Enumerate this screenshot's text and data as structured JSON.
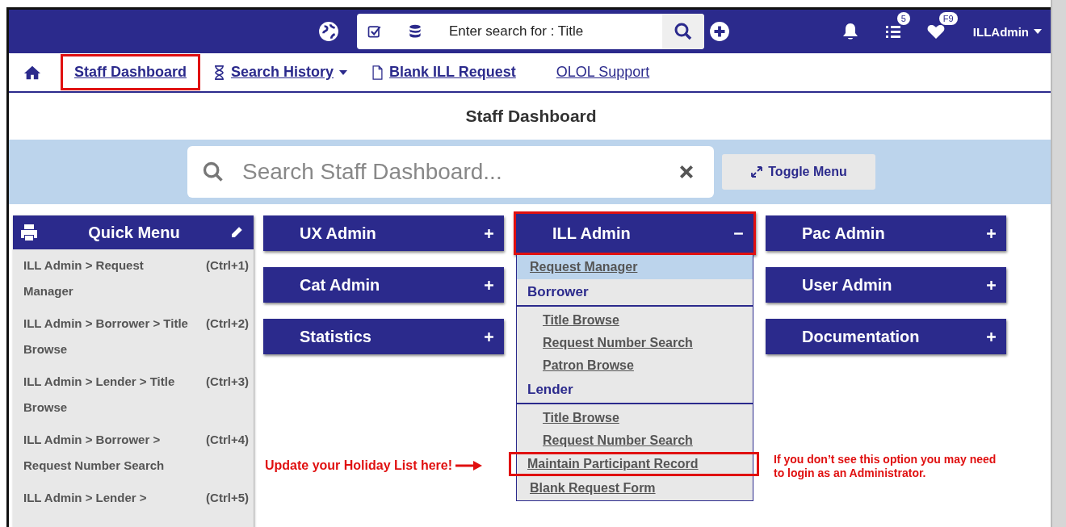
{
  "top_bar": {
    "search_placeholder": "Enter search for : Title",
    "list_badge": "5",
    "heart_badge": "F9",
    "user": "ILLAdmin"
  },
  "nav": [
    {
      "label": "Staff Dashboard",
      "kind": "page",
      "highlighted": true
    },
    {
      "label": "Search History",
      "kind": "history",
      "highlighted": false
    },
    {
      "label": "Blank ILL Request",
      "kind": "document",
      "highlighted": false
    },
    {
      "label": "OLOL Support",
      "kind": "external",
      "highlighted": false
    }
  ],
  "page_title": "Staff Dashboard",
  "dashboard_search": {
    "placeholder": "Search Staff Dashboard...",
    "toggle": "Toggle Menu"
  },
  "quick_menu": {
    "title": "Quick Menu",
    "items": [
      {
        "label": "ILL Admin > Request Manager",
        "shortcut": "(Ctrl+1)"
      },
      {
        "label": "ILL Admin > Borrower > Title Browse",
        "shortcut": "(Ctrl+2)"
      },
      {
        "label": "ILL Admin > Lender > Title Browse",
        "shortcut": "(Ctrl+3)"
      },
      {
        "label": "ILL Admin > Borrower > Request Number Search",
        "shortcut": "(Ctrl+4)"
      },
      {
        "label": "ILL Admin > Lender >",
        "shortcut": "(Ctrl+5)"
      }
    ]
  },
  "panel_columns": [
    [
      {
        "title": "UX Admin",
        "expanded": false,
        "highlighted": false
      },
      {
        "title": "Cat Admin",
        "expanded": false,
        "highlighted": false
      },
      {
        "title": "Statistics",
        "expanded": false,
        "highlighted": false
      }
    ],
    [
      {
        "title": "ILL Admin",
        "expanded": true,
        "highlighted": true,
        "items": [
          {
            "kind": "link",
            "label": "Request Manager",
            "selected": true,
            "highlighted": false
          },
          {
            "kind": "heading",
            "label": "Borrower",
            "children": [
              {
                "label": "Title Browse"
              },
              {
                "label": "Request Number Search"
              },
              {
                "label": "Patron Browse"
              }
            ]
          },
          {
            "kind": "heading",
            "label": "Lender",
            "children": [
              {
                "label": "Title Browse"
              },
              {
                "label": "Request Number Search"
              }
            ]
          },
          {
            "kind": "link",
            "label": "Maintain Participant Record",
            "selected": false,
            "highlighted": true
          },
          {
            "kind": "link",
            "label": "Blank Request Form",
            "selected": false,
            "highlighted": false
          }
        ]
      }
    ],
    [
      {
        "title": "Pac Admin",
        "expanded": false,
        "highlighted": false
      },
      {
        "title": "User Admin",
        "expanded": false,
        "highlighted": false
      },
      {
        "title": "Documentation",
        "expanded": false,
        "highlighted": false
      }
    ]
  ],
  "annotations": {
    "pointer": "Update your Holiday List here!",
    "note": "If you don’t see this option you may need to login as an Administrator."
  }
}
